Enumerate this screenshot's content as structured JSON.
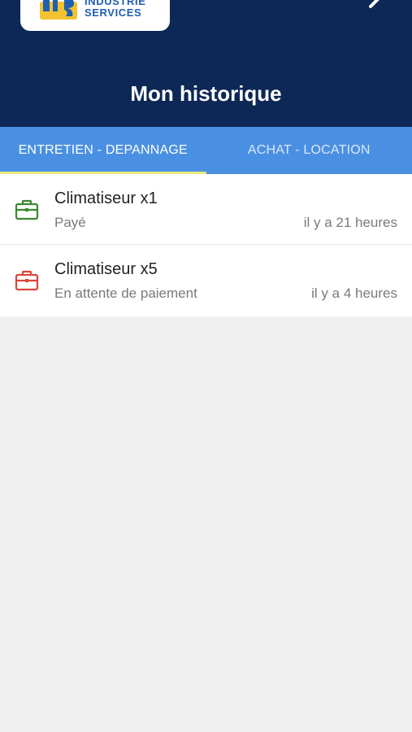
{
  "header": {
    "logo": {
      "line1": "INDUSTRIE",
      "line2": "SERVICES",
      "icon": "company-logo"
    },
    "back_icon": "chevron-left-icon",
    "title": "Mon historique",
    "background_color": "#0d2857"
  },
  "tabs": {
    "items": [
      {
        "label": "ENTRETIEN - DEPANNAGE",
        "active": true
      },
      {
        "label": "ACHAT - LOCATION",
        "active": false
      }
    ],
    "background_color": "#4a90e2",
    "indicator_color": "#e8e87a"
  },
  "history": {
    "items": [
      {
        "title": "Climatiseur x1",
        "status": "Payé",
        "time": "il y a 21 heures",
        "icon": "briefcase-icon",
        "icon_color": "#3a8a2e"
      },
      {
        "title": "Climatiseur x5",
        "status": "En attente de paiement",
        "time": "il y a 4 heures",
        "icon": "briefcase-icon",
        "icon_color": "#d9473b"
      }
    ]
  }
}
